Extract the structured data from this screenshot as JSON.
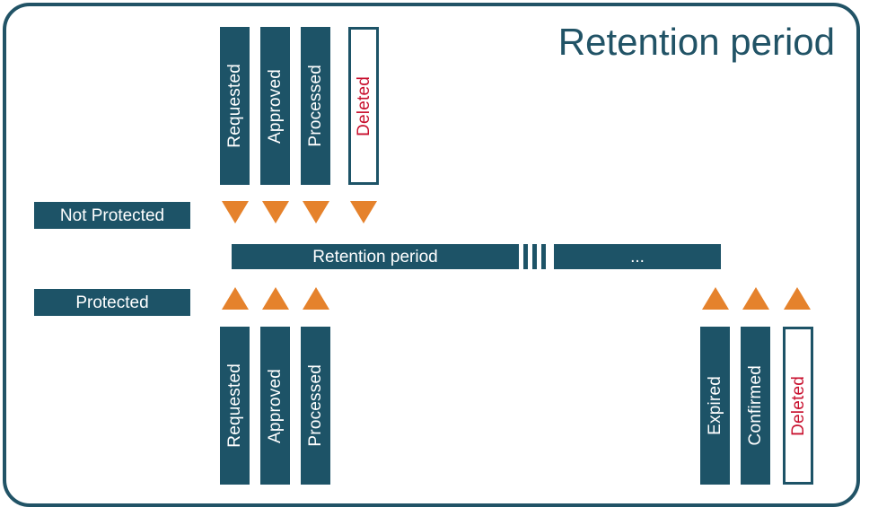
{
  "diagram": {
    "title": "Retention period",
    "colors": {
      "teal": "#1d5367",
      "frame": "#215366",
      "orange": "#e5822c",
      "red": "#c8102e",
      "white": "#ffffff"
    },
    "rows": {
      "not_protected": {
        "label": "Not Protected",
        "stages": [
          {
            "label": "Requested",
            "style": "filled"
          },
          {
            "label": "Approved",
            "style": "filled"
          },
          {
            "label": "Processed",
            "style": "filled"
          },
          {
            "label": "Deleted",
            "style": "hollow"
          }
        ],
        "markers": [
          {
            "direction": "down"
          },
          {
            "direction": "down"
          },
          {
            "direction": "down"
          },
          {
            "direction": "down"
          }
        ]
      },
      "protected": {
        "label": "Protected",
        "stages_start": [
          {
            "label": "Requested",
            "style": "filled"
          },
          {
            "label": "Approved",
            "style": "filled"
          },
          {
            "label": "Processed",
            "style": "filled"
          }
        ],
        "stages_end": [
          {
            "label": "Expired",
            "style": "filled"
          },
          {
            "label": "Confirmed",
            "style": "filled"
          },
          {
            "label": "Deleted",
            "style": "hollow"
          }
        ],
        "markers_start": [
          {
            "direction": "up"
          },
          {
            "direction": "up"
          },
          {
            "direction": "up"
          }
        ],
        "markers_end": [
          {
            "direction": "up"
          },
          {
            "direction": "up"
          },
          {
            "direction": "up"
          }
        ]
      }
    },
    "timeline": {
      "segment_left_label": "Retention period",
      "segment_right_label": "...",
      "break_ticks": 3
    }
  }
}
